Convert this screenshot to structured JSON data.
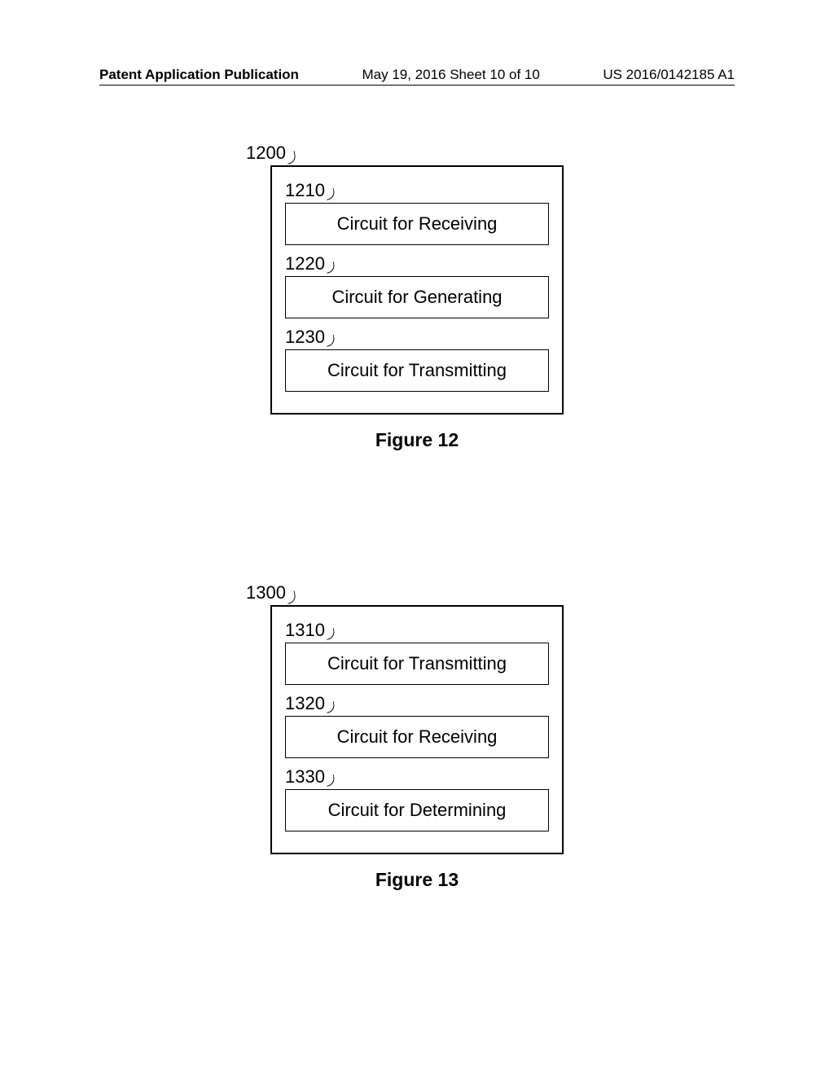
{
  "header": {
    "left": "Patent Application Publication",
    "middle": "May 19, 2016  Sheet 10 of 10",
    "right": "US 2016/0142185 A1"
  },
  "figures": [
    {
      "outer_ref": "1200",
      "caption": "Figure 12",
      "boxes": [
        {
          "ref": "1210",
          "label": "Circuit for Receiving"
        },
        {
          "ref": "1220",
          "label": "Circuit for Generating"
        },
        {
          "ref": "1230",
          "label": "Circuit for Transmitting"
        }
      ]
    },
    {
      "outer_ref": "1300",
      "caption": "Figure 13",
      "boxes": [
        {
          "ref": "1310",
          "label": "Circuit for Transmitting"
        },
        {
          "ref": "1320",
          "label": "Circuit for Receiving"
        },
        {
          "ref": "1330",
          "label": "Circuit for Determining"
        }
      ]
    }
  ]
}
